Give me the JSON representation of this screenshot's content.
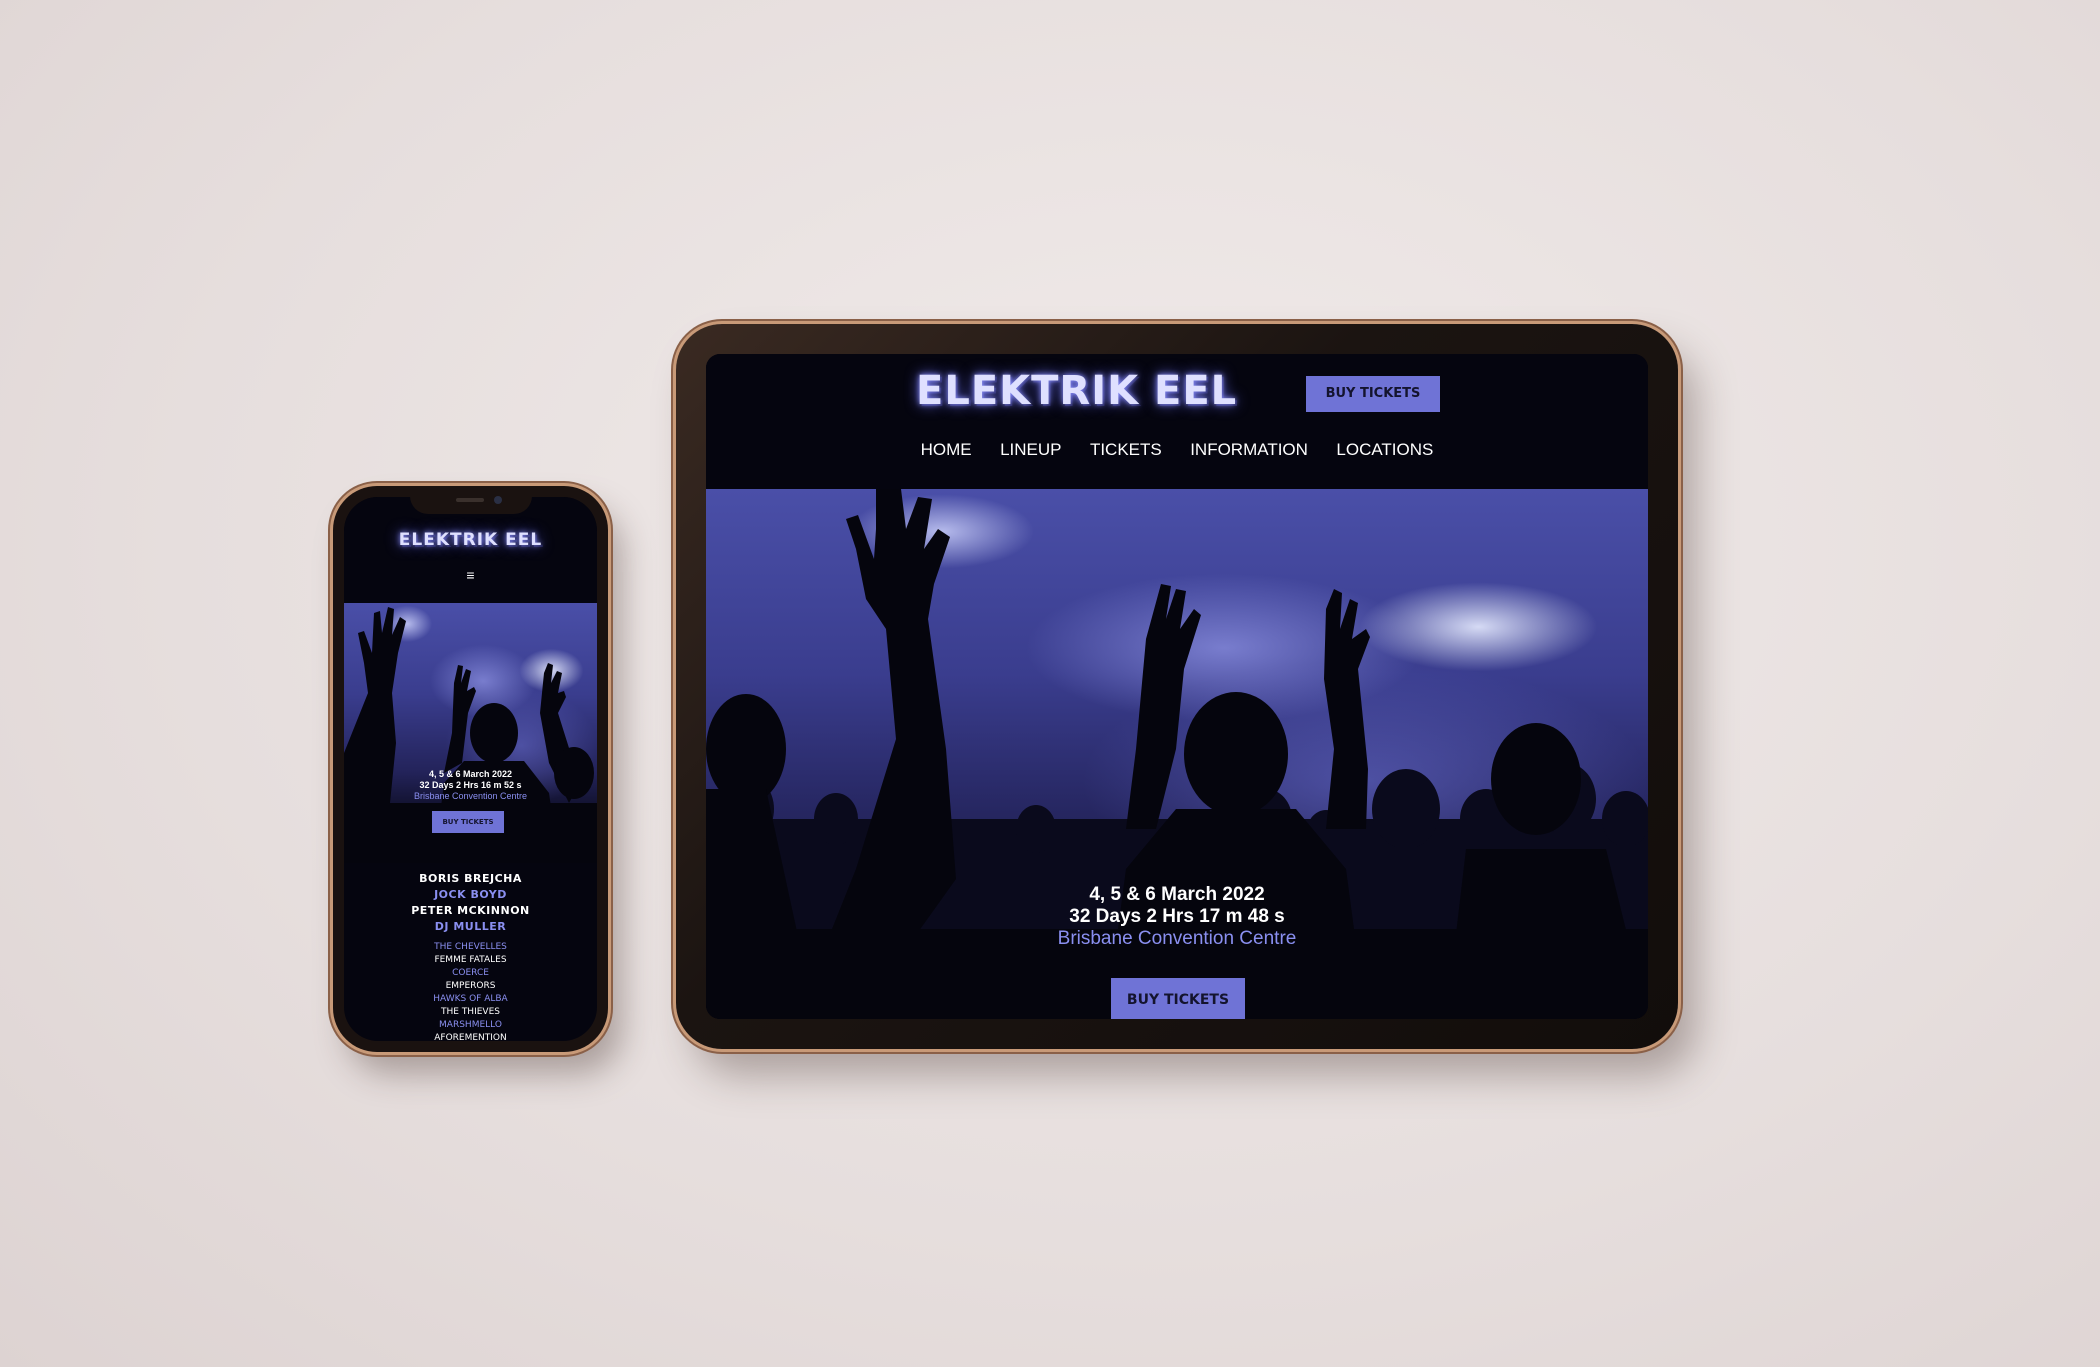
{
  "site": {
    "logo": "ELEKTRIK EEL",
    "buy_tickets": "BUY TICKETS",
    "menu_icon": "≡",
    "colors": {
      "background": "#05050f",
      "accent": "#6f73d6",
      "accent_text": "#8a8ff0"
    }
  },
  "tablet": {
    "nav": [
      "HOME",
      "LINEUP",
      "TICKETS",
      "INFORMATION",
      "LOCATIONS"
    ],
    "date": "4, 5 & 6 March 2022",
    "countdown": "32 Days 2 Hrs 17 m 48 s",
    "venue": "Brisbane Convention Centre"
  },
  "phone": {
    "date": "4, 5 & 6 March 2022",
    "countdown": "32 Days 2 Hrs 16 m 52 s",
    "venue": "Brisbane Convention Centre",
    "headliners": [
      "BORIS BREJCHA",
      "JOCK BOYD",
      "PETER MCKINNON",
      "DJ MULLER"
    ],
    "acts": [
      "THE CHEVELLES",
      "FEMME FATALES",
      "COERCE",
      "EMPERORS",
      "HAWKS OF ALBA",
      "THE THIEVES",
      "MARSHMELLO",
      "AFOREMENTION"
    ]
  }
}
